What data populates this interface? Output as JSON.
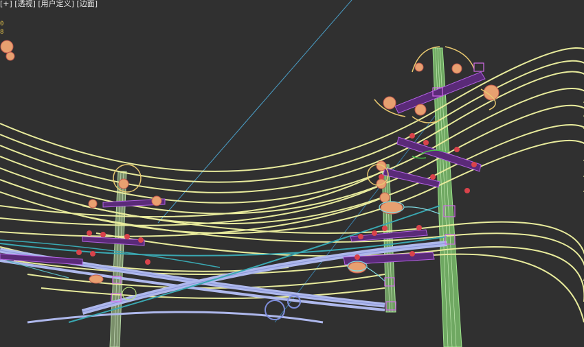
{
  "viewport": {
    "label": "[+] [透视] [用户定义] [边面]",
    "stats": [
      "0",
      "8"
    ]
  },
  "colors": {
    "background": "#303030",
    "wire": "#e8eb9c",
    "pole": "#98d48a",
    "crossarm": "#5a2a78",
    "insulator": "#d9434b",
    "transformer": "#e8a070",
    "cable": "#aeb8ec",
    "cable_teal": "#3aa8b2",
    "guy_wire": "#4a9ec7"
  },
  "scene": {
    "objects": [
      "pole-left",
      "pole-middle",
      "pole-right",
      "power-lines",
      "cables",
      "crossarms",
      "insulators",
      "transformers",
      "streetlights",
      "guy-wire"
    ]
  }
}
